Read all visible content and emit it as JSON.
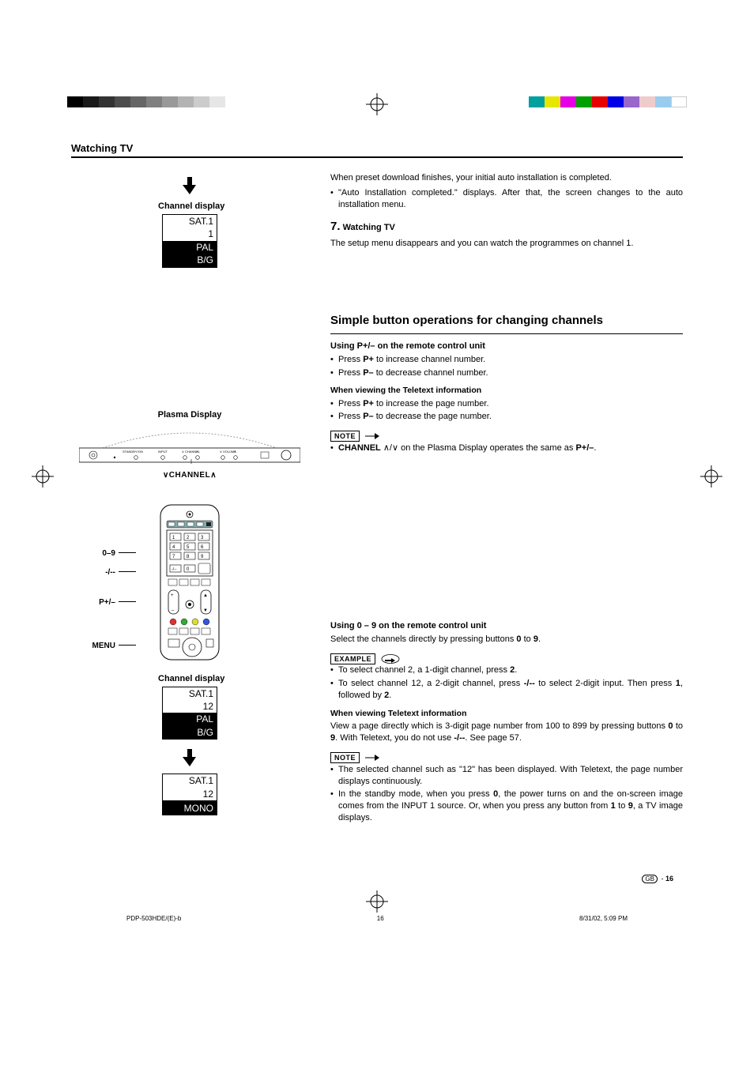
{
  "header": {
    "section_title": "Watching TV"
  },
  "left": {
    "channel_display_label": "Channel display",
    "osd1": {
      "r1": "SAT.1",
      "r2": "1",
      "r3": "PAL",
      "r4": "B/G"
    },
    "plasma_title": "Plasma Display",
    "plasma_labels": {
      "standby": "STANDBY/ON",
      "input": "INPUT",
      "channel": "CHANNEL",
      "volume": "VOLUME"
    },
    "channel_caret_label": "CHANNEL",
    "remote_callouts": {
      "digits": "0–9",
      "dashes": "-/--",
      "pplusminus": "P+/–",
      "menu": "MENU"
    },
    "channel_display_label2": "Channel display",
    "osd2": {
      "r1": "SAT.1",
      "r2": "12",
      "r3": "PAL",
      "r4": "B/G"
    },
    "osd3": {
      "r1": "SAT.1",
      "r2": "12",
      "r3": "",
      "r4": "MONO"
    }
  },
  "right": {
    "intro_p1": "When preset download finishes, your initial auto installation is completed.",
    "intro_li1": "\"Auto Installation completed.\" displays. After that, the screen changes to the auto installation menu.",
    "step7_num": "7.",
    "step7_title": "Watching TV",
    "step7_body": "The setup menu disappears and you can watch the programmes on channel 1.",
    "h2_simple": "Simple button operations for changing channels",
    "h3_using_p": "Using P+/– on the remote control unit",
    "p_inc_pre": "Press ",
    "p_inc_key": "P+",
    "p_inc_post": " to increase channel number.",
    "p_dec_pre": "Press ",
    "p_dec_key": "P–",
    "p_dec_post": " to decrease channel number.",
    "h4_tele1": "When viewing the Teletext information",
    "t_inc_pre": "Press ",
    "t_inc_key": "P+",
    "t_inc_post": " to increase the page number.",
    "t_dec_pre": "Press ",
    "t_dec_key": "P–",
    "t_dec_post": " to decrease the page number.",
    "note_label": "NOTE",
    "note1_pre": "",
    "note1_bold": "CHANNEL",
    "note1_mid": " ",
    "note1_post": " on the Plasma Display operates the same as ",
    "note1_key": "P+/–",
    "note1_end": ".",
    "h3_using_09": "Using 0 – 9 on the remote control unit",
    "sel_pre": "Select the channels directly by pressing buttons ",
    "sel_b0": "0",
    "sel_mid": " to ",
    "sel_b9": "9",
    "sel_end": ".",
    "example_label": "EXAMPLE",
    "ex_li1_pre": "To select channel 2, a 1-digit channel, press ",
    "ex_li1_b": "2",
    "ex_li1_end": ".",
    "ex_li2_pre": "To select channel 12, a 2-digit channel, press ",
    "ex_li2_b1": "-/--",
    "ex_li2_mid": " to select 2-digit input. Then press ",
    "ex_li2_b2": "1",
    "ex_li2_mid2": ", followed by ",
    "ex_li2_b3": "2",
    "ex_li2_end": ".",
    "h4_tele2": "When viewing Teletext information",
    "tele2_p_pre": "View a page directly which is 3-digit page number from 100 to 899 by pressing buttons ",
    "tele2_b0": "0",
    "tele2_mid": " to ",
    "tele2_b9": "9",
    "tele2_post": ". With Teletext, you do not use ",
    "tele2_key": "-/--",
    "tele2_end": ". See page 57.",
    "note2_li1": "The selected channel such as \"12\" has been displayed. With Teletext, the page number displays continuously.",
    "note2_li2_pre": "In the standby mode, when you press ",
    "note2_li2_b0": "0",
    "note2_li2_mid": ", the power turns on and the on-screen image comes from the INPUT 1 source. Or, when you press any button from ",
    "note2_li2_b1": "1",
    "note2_li2_mid2": " to ",
    "note2_li2_b9": "9",
    "note2_li2_end": ", a TV image displays."
  },
  "footer": {
    "gb": "GB",
    "page": "16"
  },
  "printline": {
    "file": "PDP-503HDE/(E)-b",
    "sig": "16",
    "ts": "8/31/02, 5:09 PM"
  },
  "colorbar_left": [
    "#000",
    "#1a1a1a",
    "#333",
    "#4d4d4d",
    "#666",
    "#808080",
    "#999",
    "#b3b3b3",
    "#ccc",
    "#e6e6e6"
  ],
  "colorbar_right": [
    "#00a0a0",
    "#e6e600",
    "#e600e6",
    "#00a000",
    "#e60000",
    "#0000e6",
    "#9966cc",
    "#eecccc",
    "#99ccee",
    "#ffffff"
  ]
}
